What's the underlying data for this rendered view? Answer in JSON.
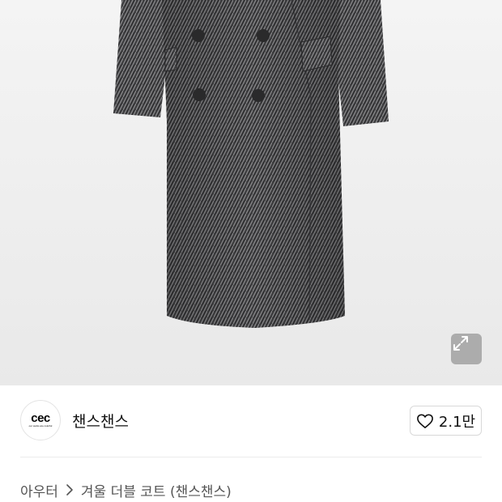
{
  "product": {
    "image_alt": "herringbone double coat",
    "expand_icon": "expand-arrows-icon"
  },
  "brand": {
    "logo_text": "cec",
    "logo_tagline": "our works are colorful",
    "name": "챈스챈스"
  },
  "like": {
    "icon": "heart-outline-icon",
    "count": "2.1만"
  },
  "breadcrumb": {
    "category": "아우터",
    "separator_icon": "chevron-right-icon",
    "product_title": "겨울 더블 코트 (챈스챈스)"
  },
  "colors": {
    "coat": "#4a4a4c",
    "background": "#efefef",
    "text": "#111111",
    "muted": "#555555"
  }
}
